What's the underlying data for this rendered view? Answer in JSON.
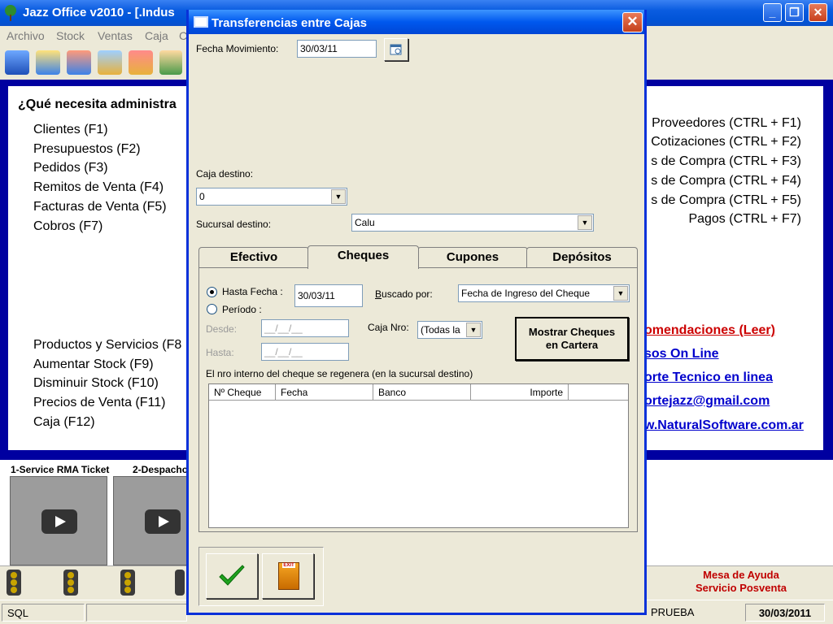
{
  "app": {
    "title": "Jazz Office v2010 - [.Indus",
    "menu": [
      "Archivo",
      "Stock",
      "Ventas",
      "Caja",
      "C"
    ]
  },
  "main": {
    "heading": "¿Qué necesita administra",
    "left_items": [
      "Clientes (F1)",
      "Presupuestos (F2)",
      "Pedidos (F3)",
      "Remitos de Venta (F4)",
      "Facturas de Venta (F5)",
      "Cobros (F7)"
    ],
    "left_items_2": [
      "Productos y Servicios (F8",
      "Aumentar Stock (F9)",
      "Disminuir Stock (F10)",
      "Precios de Venta (F11)",
      "Caja (F12)"
    ],
    "right_items": [
      "Proveedores (CTRL + F1)",
      "Cotizaciones (CTRL + F2)",
      "s de Compra (CTRL + F3)",
      "s de Compra (CTRL + F4)",
      "s de Compra (CTRL + F5)",
      "Pagos (CTRL + F7)"
    ],
    "links": [
      "omendaciones (Leer)",
      "sos On Line",
      "orte Tecnico en linea",
      "ortejazz@gmail.com",
      "w.NaturalSoftware.com.ar"
    ]
  },
  "videos": [
    "1-Service RMA Ticket",
    "2-Despacho"
  ],
  "help": {
    "line1": "Mesa de Ayuda",
    "line2": "Servicio Posventa"
  },
  "status": {
    "db": "SQL",
    "company": "PRUEBA",
    "date": "30/03/2011"
  },
  "dialog": {
    "title": "Transferencias entre Cajas",
    "fecha_label": "Fecha Movimiento:",
    "fecha_value": "30/03/11",
    "caja_destino_label": "Caja destino:",
    "caja_destino_value": "0",
    "sucursal_label": "Sucursal destino:",
    "sucursal_value": "Calu",
    "tabs": [
      "Efectivo",
      "Cheques",
      "Cupones",
      "Depósitos"
    ],
    "active_tab": "Cheques",
    "hasta_fecha_label": "Hasta Fecha :",
    "hasta_fecha_value": "30/03/11",
    "periodo_label": "Período :",
    "buscado_label": "Buscado por:",
    "buscado_value": "Fecha de Ingreso del Cheque",
    "desde_label": "Desde:",
    "desde_value": "__/__/__",
    "hasta_label": "Hasta:",
    "hasta_value": "__/__/__",
    "caja_nro_label": "Caja Nro:",
    "caja_nro_value": "(Todas la",
    "mostrar_line1": "Mostrar Cheques",
    "mostrar_line2": "en Cartera",
    "note": "El nro interno del cheque se regenera (en la sucursal destino)",
    "columns": [
      "Nº Cheque",
      "Fecha",
      "Banco",
      "Importe"
    ],
    "exit_label": "EXIT"
  },
  "colors": {
    "accent": "#0000a0",
    "link": "#0000cc",
    "link_red": "#cc0000",
    "help": "#c00000"
  }
}
